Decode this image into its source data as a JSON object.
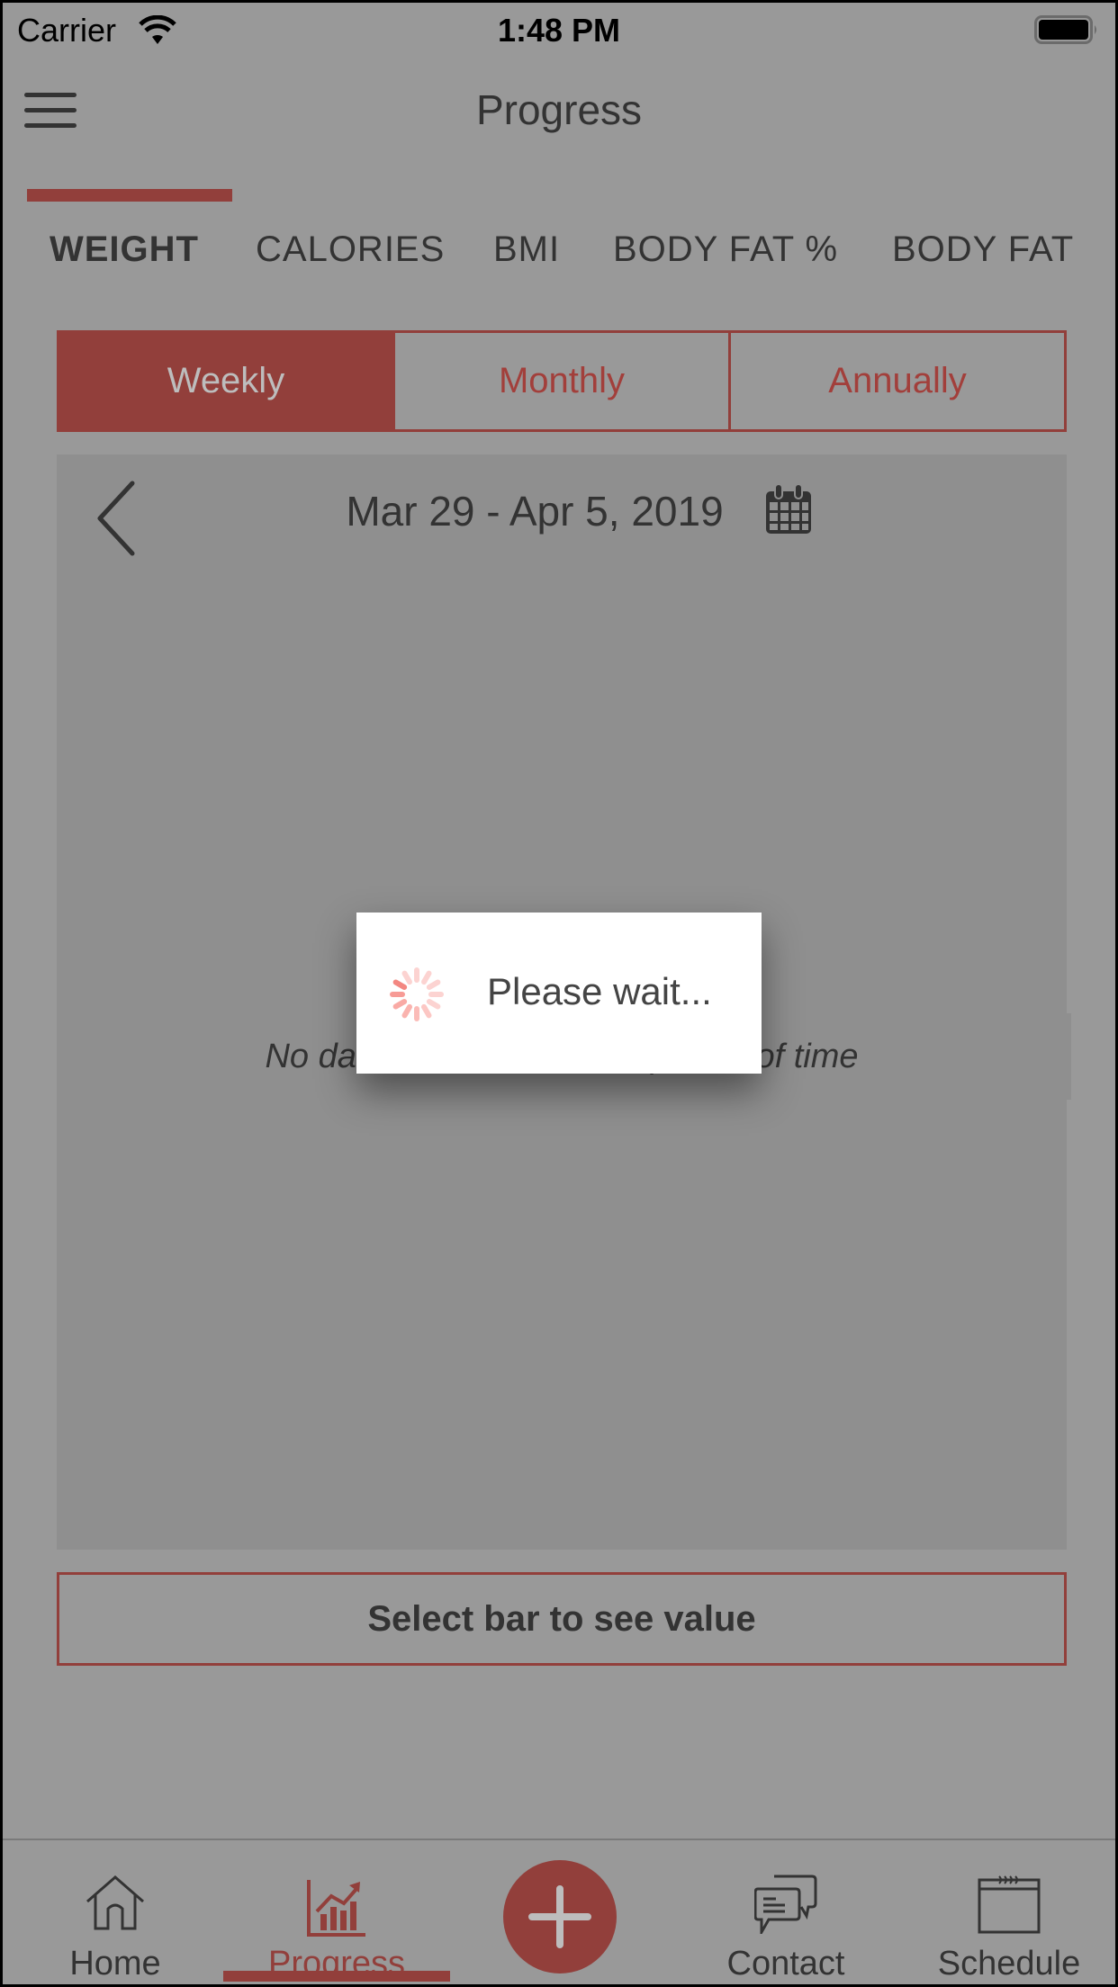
{
  "status_bar": {
    "carrier": "Carrier",
    "time": "1:48 PM",
    "wifi_icon": "wifi-icon",
    "battery_icon": "battery-full-icon"
  },
  "nav": {
    "title": "Progress",
    "menu_icon": "hamburger-menu-icon"
  },
  "metric_tabs": [
    {
      "label": "WEIGHT",
      "active": true
    },
    {
      "label": "CALORIES",
      "active": false
    },
    {
      "label": "BMI",
      "active": false
    },
    {
      "label": "BODY FAT %",
      "active": false
    },
    {
      "label": "BODY FAT",
      "active": false
    }
  ],
  "period_selector": {
    "options": [
      "Weekly",
      "Monthly",
      "Annually"
    ],
    "selected": "Weekly"
  },
  "chart": {
    "date_range": "Mar 29 - Apr 5, 2019",
    "prev_icon": "chevron-left-icon",
    "calendar_icon": "calendar-icon",
    "empty_message": "No data available for this period of time"
  },
  "loading_popup": {
    "message": "Please wait...",
    "spinner_icon": "spinner-icon"
  },
  "select_bar": {
    "label": "Select bar to see value"
  },
  "tab_bar": {
    "items": [
      {
        "label": "Home",
        "icon": "home-icon",
        "active": false
      },
      {
        "label": "Progress",
        "icon": "progress-chart-icon",
        "active": true
      },
      {
        "label": "",
        "icon": "plus-icon",
        "active": false
      },
      {
        "label": "Contact",
        "icon": "chat-bubbles-icon",
        "active": false
      },
      {
        "label": "Schedule",
        "icon": "calendar-page-icon",
        "active": false
      }
    ]
  },
  "colors": {
    "accent": "#923f3b",
    "background_dim": "#999999",
    "panel": "#8f8f8f",
    "text": "#333333"
  }
}
